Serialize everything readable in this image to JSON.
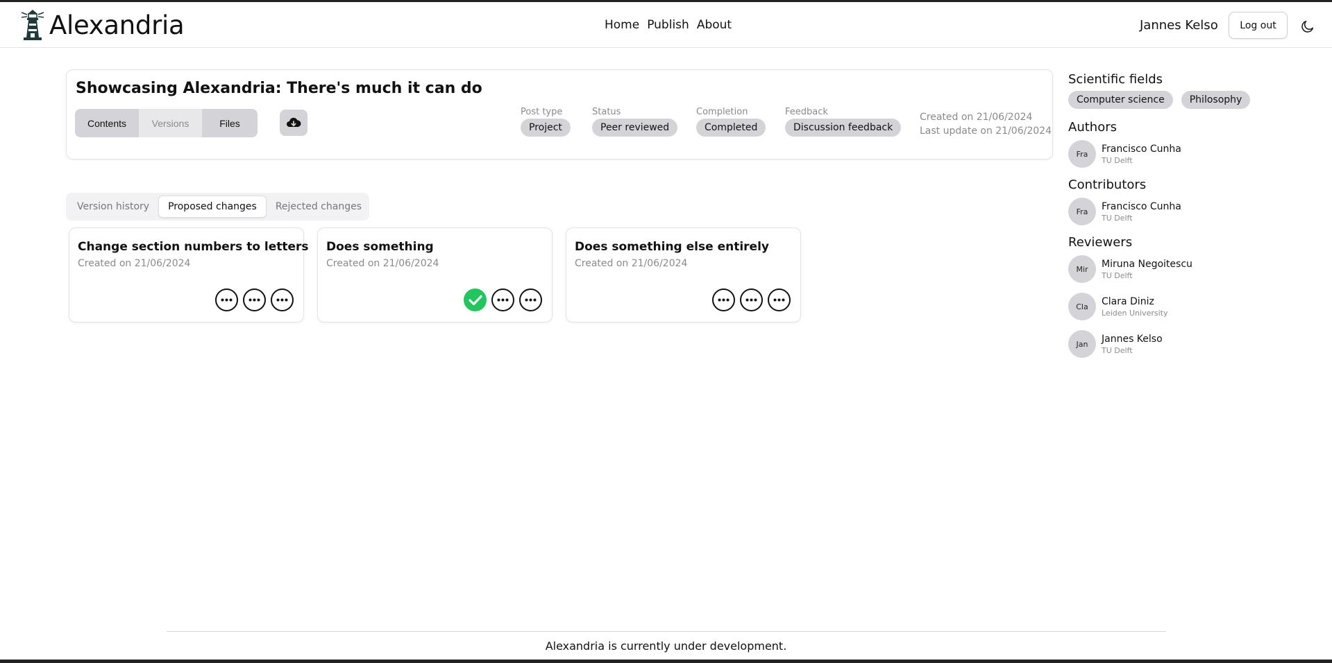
{
  "header": {
    "app_name": "Alexandria",
    "nav": [
      "Home",
      "Publish",
      "About"
    ],
    "user_name": "Jannes Kelso",
    "logout_label": "Log out"
  },
  "post": {
    "title": "Showcasing Alexandria: There's much it can do",
    "view_tabs": [
      "Contents",
      "Versions",
      "Files"
    ],
    "meta": [
      {
        "label": "Post type",
        "value": "Project"
      },
      {
        "label": "Status",
        "value": "Peer reviewed"
      },
      {
        "label": "Completion",
        "value": "Completed"
      },
      {
        "label": "Feedback",
        "value": "Discussion feedback"
      }
    ],
    "created": "Created on 21/06/2024",
    "updated": "Last update on 21/06/2024"
  },
  "change_tabs": {
    "items": [
      "Version history",
      "Proposed changes",
      "Rejected changes"
    ],
    "active": "Proposed changes"
  },
  "changes": [
    {
      "title": "Change section numbers to letters",
      "date": "Created on 21/06/2024",
      "approved": false
    },
    {
      "title": "Does something",
      "date": "Created on 21/06/2024",
      "approved": true
    },
    {
      "title": "Does something else entirely",
      "date": "Created on 21/06/2024",
      "approved": false
    }
  ],
  "sidebar": {
    "fields_heading": "Scientific fields",
    "fields": [
      "Computer science",
      "Philosophy"
    ],
    "authors_heading": "Authors",
    "authors": [
      {
        "initials": "Fra",
        "name": "Francisco Cunha",
        "affiliation": "TU Delft"
      }
    ],
    "contributors_heading": "Contributors",
    "contributors": [
      {
        "initials": "Fra",
        "name": "Francisco Cunha",
        "affiliation": "TU Delft"
      }
    ],
    "reviewers_heading": "Reviewers",
    "reviewers": [
      {
        "initials": "Mir",
        "name": "Miruna Negoitescu",
        "affiliation": "TU Delft"
      },
      {
        "initials": "Cla",
        "name": "Clara Diniz",
        "affiliation": "Leiden University"
      },
      {
        "initials": "Jan",
        "name": "Jannes Kelso",
        "affiliation": "TU Delft"
      }
    ]
  },
  "footer": {
    "text": "Alexandria is currently under development."
  },
  "colors": {
    "approved": "#22c55e",
    "pill_bg": "#d4d4d8",
    "muted_text": "#8a8a8a"
  },
  "icons": {
    "logo": "lighthouse-icon",
    "theme": "moon-icon",
    "download": "cloud-download-icon",
    "more": "more-options-icon",
    "approved": "check-icon"
  }
}
